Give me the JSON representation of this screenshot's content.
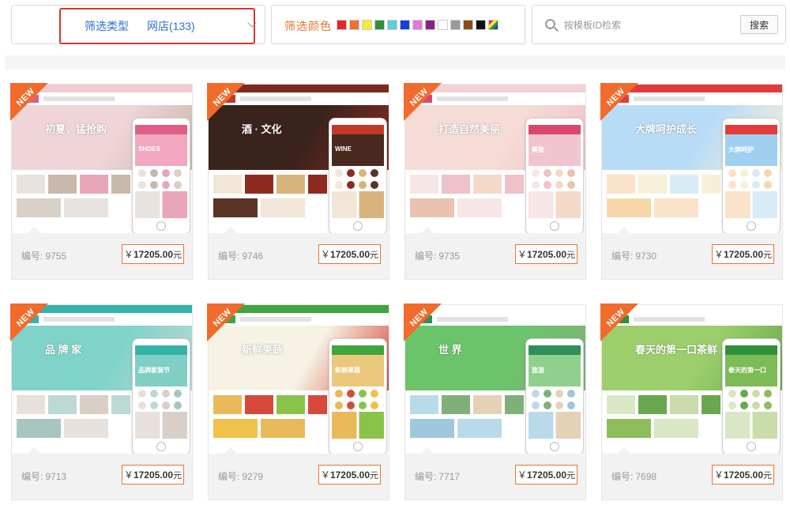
{
  "filter": {
    "type_label": "筛选类型",
    "type_value": "网店(133)",
    "color_label": "筛选颜色",
    "colors": [
      "#e8262a",
      "#f07032",
      "#f5e83a",
      "#2f8f3a",
      "#5ccfd4",
      "#1a3fd8",
      "#e477d9",
      "#8a1e8d",
      "#ffffff",
      "#9a9a9a",
      "#8a4d18",
      "#111111",
      "multi"
    ],
    "search_placeholder": "按模板ID检索",
    "search_button": "搜索"
  },
  "labels": {
    "num_prefix": "编号:",
    "currency": "￥",
    "unit": "元",
    "badge": "NEW"
  },
  "templates": [
    {
      "id": "9755",
      "price": "17205.00",
      "theme": {
        "top": "#f3c9d3",
        "hero": "#f0d5d8",
        "accent": "#e05d86",
        "hero_text": "初夏，猛抢购",
        "body": [
          "#e8e3df",
          "#c9b9ab",
          "#e9a6b8",
          "#d9d0c6"
        ],
        "phone_banner": "#f2a7c0",
        "phone_text": "SHOES"
      }
    },
    {
      "id": "9746",
      "price": "17205.00",
      "theme": {
        "top": "#7b2a1f",
        "hero": "#3b231d",
        "accent": "#c0392b",
        "hero_text": "酒 · 文化",
        "body": [
          "#f1e6d8",
          "#8e2b20",
          "#d8b47c",
          "#5a3327"
        ],
        "phone_banner": "#4a2a20",
        "phone_text": "WINE"
      }
    },
    {
      "id": "9735",
      "price": "17205.00",
      "theme": {
        "top": "#f2d2d6",
        "hero": "#f6dcd6",
        "accent": "#d9476e",
        "hero_text": "打造自然美丽",
        "body": [
          "#f7e6e6",
          "#efc1c8",
          "#f4d9c9",
          "#e9c3b0"
        ],
        "phone_banner": "#f1c5cf",
        "phone_text": "美妆"
      }
    },
    {
      "id": "9730",
      "price": "17205.00",
      "theme": {
        "top": "#e33b3b",
        "hero": "#b9dcf6",
        "accent": "#e33b3b",
        "hero_text": "大牌呵护成长",
        "body": [
          "#fbe2ca",
          "#f7f0d8",
          "#d8ecf6",
          "#f7d7a9"
        ],
        "phone_banner": "#9fd0f2",
        "phone_text": "大牌呵护"
      }
    },
    {
      "id": "9713",
      "price": "17205.00",
      "theme": {
        "top": "#34b3a8",
        "hero": "#7fd3c9",
        "accent": "#34b3a8",
        "hero_text": "品 牌 家",
        "body": [
          "#e8e1db",
          "#bcd9d3",
          "#d9cfc6",
          "#a7c6c1"
        ],
        "phone_banner": "#7fcfc4",
        "phone_text": "品牌家装节"
      }
    },
    {
      "id": "9279",
      "price": "17205.00",
      "theme": {
        "top": "#3fa53c",
        "hero": "#f6f3e4",
        "accent": "#3fa53c",
        "hero_text": "新鲜果蔬",
        "body": [
          "#e9b95a",
          "#d6493b",
          "#8bc34a",
          "#f0c14b"
        ],
        "phone_banner": "#eac77a",
        "phone_text": "新鲜果蔬"
      }
    },
    {
      "id": "7717",
      "price": "17205.00",
      "theme": {
        "top": "#ffffff",
        "hero": "#6cc46a",
        "accent": "#2d8f5a",
        "hero_text": "世 界",
        "body": [
          "#b9dbe9",
          "#7fb07a",
          "#e3d2b8",
          "#9fc7de"
        ],
        "phone_banner": "#8fd18c",
        "phone_text": "旅游"
      }
    },
    {
      "id": "7698",
      "price": "17205.00",
      "theme": {
        "top": "#ffffff",
        "hero": "#9ccf6b",
        "accent": "#2f8f3a",
        "hero_text": "春天的第一口茶鲜",
        "body": [
          "#d9e8c4",
          "#6aa84f",
          "#c9dca9",
          "#8cbf5b"
        ],
        "phone_banner": "#7dbb56",
        "phone_text": "春天的第一口"
      }
    }
  ]
}
